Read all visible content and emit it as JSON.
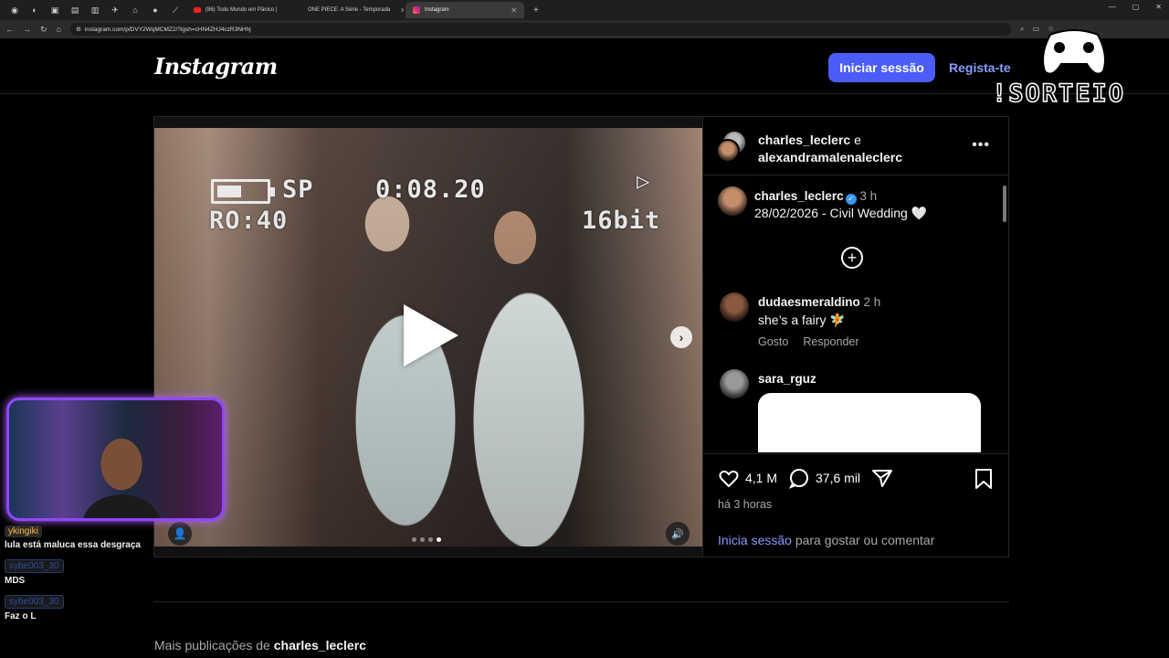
{
  "browser": {
    "tabs": [
      {
        "label": "(86) Todo Mundo em Pânico |"
      },
      {
        "label": "ONE PIECE: A Série - Temporada"
      },
      {
        "label": "Instagram",
        "active": true
      }
    ],
    "url": "instagram.com/p/DVY2WqMCMZ2/?igsh=cHN4ZHJ4czR3NHhj"
  },
  "header": {
    "logo": "Instagram",
    "login_button": "Iniciar sessão",
    "register_link": "Regista-te"
  },
  "overlay": {
    "sorteio": "!SORTEIO"
  },
  "post": {
    "video_osd": {
      "mode": "SP",
      "time": "0:08.20",
      "ro": "RO:40",
      "bits": "16bit"
    },
    "carousel": {
      "count": 4,
      "active_index": 3
    },
    "header": {
      "user1": "charles_leclerc",
      "joiner": "e",
      "user2": "alexandramalenaleclerc"
    },
    "caption": {
      "user": "charles_leclerc",
      "time": "3 h",
      "text": "28/02/2026 - Civil Wedding 🤍"
    },
    "comments": [
      {
        "user": "dudaesmeraldino",
        "time": "2 h",
        "text": "she’s a fairy 🧚",
        "like": "Gosto",
        "reply": "Responder"
      },
      {
        "user": "sara_rguz"
      }
    ],
    "likes": "4,1 M",
    "comment_count": "37,6 mil",
    "time_ago": "há 3 horas",
    "login_prompt": {
      "link": "Inicia sessão",
      "rest": " para gostar ou comentar"
    }
  },
  "more_posts": {
    "prefix": "Mais publicações de ",
    "user": "charles_leclerc"
  },
  "chat": [
    {
      "user": "ykingiki",
      "message": "lula está maluca essa desgraça"
    },
    {
      "user": "sybe003_30",
      "message": "MDS"
    },
    {
      "user": "sybe003_30",
      "message": "Faz o L"
    }
  ],
  "colors": {
    "accent": "#4a5df9",
    "link": "#8a9bff",
    "cam_border": "#8f46ff"
  }
}
